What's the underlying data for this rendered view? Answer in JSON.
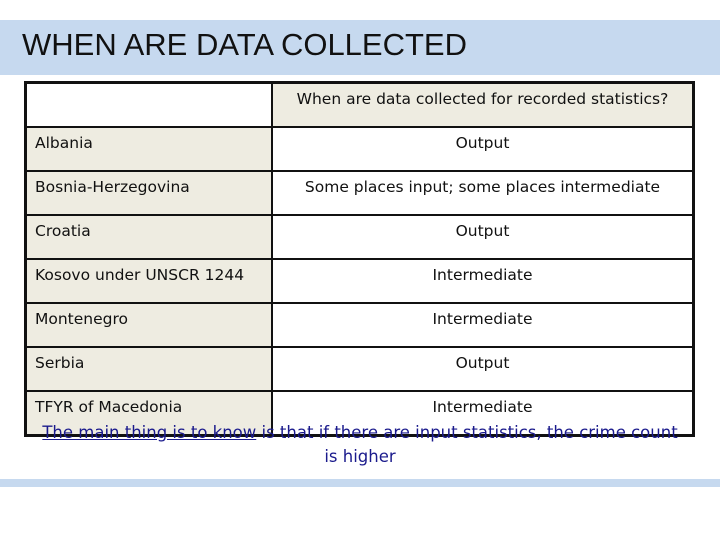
{
  "title": "WHEN ARE DATA COLLECTED",
  "table": {
    "header": {
      "col1": "",
      "col2": "When are data collected for recorded statistics?"
    },
    "rows": [
      {
        "country": "Albania",
        "when": "Output"
      },
      {
        "country": "Bosnia-Herzegovina",
        "when": "Some places input; some places intermediate"
      },
      {
        "country": "Croatia",
        "when": "Output"
      },
      {
        "country": "Kosovo under UNSCR 1244",
        "when": "Intermediate"
      },
      {
        "country": "Montenegro",
        "when": "Intermediate"
      },
      {
        "country": "Serbia",
        "when": "Output"
      },
      {
        "country": "TFYR of Macedonia",
        "when": "Intermediate"
      }
    ]
  },
  "note": {
    "underlined": "The main thing is to know",
    "rest": " is that if there are input statistics, the crime count is higher"
  },
  "colors": {
    "band": "#c6d9ef",
    "cell_shade": "#eeece1",
    "note_text": "#1a1a8c"
  }
}
